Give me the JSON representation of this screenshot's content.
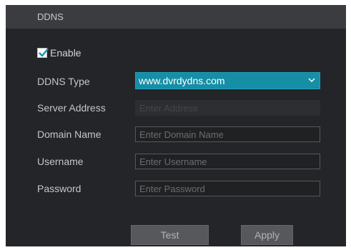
{
  "header": {
    "title": "DDNS"
  },
  "enable": {
    "label": "Enable",
    "checked": true
  },
  "ddns_type": {
    "label": "DDNS Type",
    "value": "www.dvrdydns.com"
  },
  "server_address": {
    "label": "Server Address",
    "placeholder": "Enter Address",
    "value": ""
  },
  "domain_name": {
    "label": "Domain Name",
    "placeholder": "Enter Domain Name",
    "value": ""
  },
  "username": {
    "label": "Username",
    "placeholder": "Enter Username",
    "value": ""
  },
  "password": {
    "label": "Password",
    "placeholder": "Enter Password",
    "value": ""
  },
  "buttons": {
    "test": "Test",
    "apply": "Apply"
  },
  "colors": {
    "panel_bg": "#232528",
    "header_bg": "#3a3c40",
    "select_accent": "#168ea6",
    "button_bg": "#56585c"
  },
  "icons": {
    "checkbox": "checkmark-icon",
    "dropdown": "chevron-down-icon"
  }
}
